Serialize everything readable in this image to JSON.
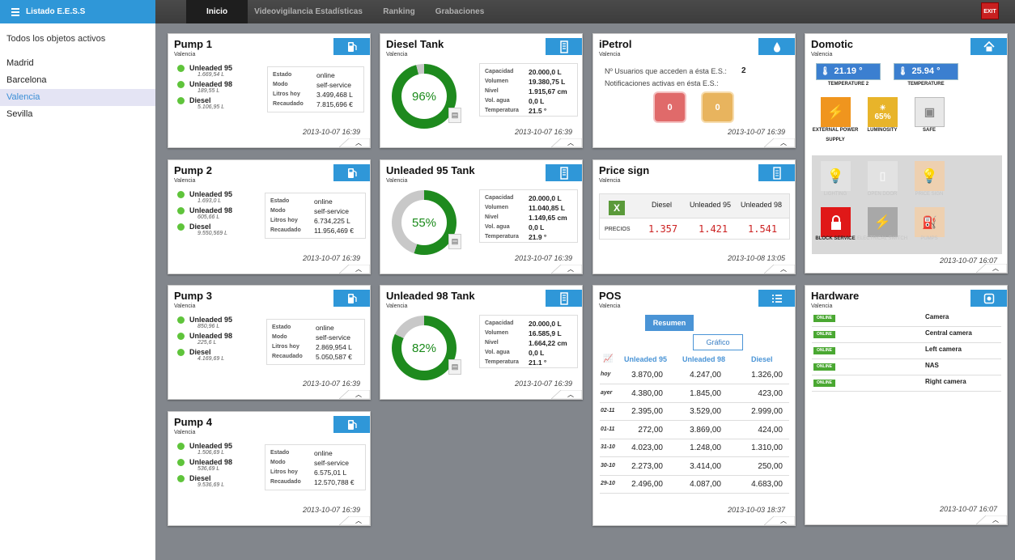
{
  "sidebar": {
    "title": "Listado E.E.S.S",
    "all_objects": "Todos los objetos activos",
    "items": [
      "Madrid",
      "Barcelona",
      "Valencia",
      "Sevilla"
    ],
    "active": "Valencia"
  },
  "nav": {
    "tabs": [
      "Inicio",
      "Videovigilancia Estadísticas",
      "Ranking",
      "Grabaciones"
    ],
    "active": "Inicio",
    "exit_label": "EXIT"
  },
  "pumps": [
    {
      "title": "Pump 1",
      "location": "Valencia",
      "fuels": [
        {
          "name": "Unleaded 95",
          "value": "1.669,54 L"
        },
        {
          "name": "Unleaded 98",
          "value": "189,55 L"
        },
        {
          "name": "Diesel",
          "value": "5.106,95 L"
        }
      ],
      "estado": "online",
      "modo": "self-service",
      "litros": "3.499,468 L",
      "recaudado": "7.815,696 €",
      "time": "2013-10-07 16:39"
    },
    {
      "title": "Pump 2",
      "location": "Valencia",
      "fuels": [
        {
          "name": "Unleaded 95",
          "value": "1.693,0 L"
        },
        {
          "name": "Unleaded 98",
          "value": "605,66 L"
        },
        {
          "name": "Diesel",
          "value": "9.550,569 L"
        }
      ],
      "estado": "online",
      "modo": "self-service",
      "litros": "6.734,225 L",
      "recaudado": "11.956,469 €",
      "time": "2013-10-07 16:39"
    },
    {
      "title": "Pump 3",
      "location": "Valencia",
      "fuels": [
        {
          "name": "Unleaded 95",
          "value": "850,96 L"
        },
        {
          "name": "Unleaded 98",
          "value": "225,6 L"
        },
        {
          "name": "Diesel",
          "value": "4.169,69 L"
        }
      ],
      "estado": "online",
      "modo": "self-service",
      "litros": "2.869,954 L",
      "recaudado": "5.050,587 €",
      "time": "2013-10-07 16:39"
    },
    {
      "title": "Pump 4",
      "location": "Valencia",
      "fuels": [
        {
          "name": "Unleaded 95",
          "value": "1.506,69 L"
        },
        {
          "name": "Unleaded 98",
          "value": "536,69 L"
        },
        {
          "name": "Diesel",
          "value": "9.536,69 L"
        }
      ],
      "estado": "online",
      "modo": "self-service",
      "litros": "6.575,01 L",
      "recaudado": "12.570,788 €",
      "time": "2013-10-07 16:39"
    }
  ],
  "pump_labels": {
    "estado": "Estado",
    "modo": "Modo",
    "litros": "Litros hoy",
    "recaudado": "Recaudado"
  },
  "tanks": [
    {
      "title": "Diesel Tank",
      "location": "Valencia",
      "percent": 96,
      "percent_label": "96%",
      "capacidad": "20.000,0 L",
      "volumen": "19.380,75 L",
      "nivel": "1.915,67 cm",
      "vol_agua": "0,0 L",
      "temperatura": "21.5 °",
      "time": "2013-10-07 16:39"
    },
    {
      "title": "Unleaded 95 Tank",
      "location": "Valencia",
      "percent": 55,
      "percent_label": "55%",
      "capacidad": "20.000,0 L",
      "volumen": "11.040,85 L",
      "nivel": "1.149,65 cm",
      "vol_agua": "0,0 L",
      "temperatura": "21.9 °",
      "time": "2013-10-07 16:39"
    },
    {
      "title": "Unleaded 98 Tank",
      "location": "Valencia",
      "percent": 82,
      "percent_label": "82%",
      "capacidad": "20.000,0 L",
      "volumen": "16.585,9 L",
      "nivel": "1.664,22 cm",
      "vol_agua": "0,0 L",
      "temperatura": "21.1 °",
      "time": "2013-10-07 16:39"
    }
  ],
  "tank_labels": {
    "capacidad": "Capacidad",
    "volumen": "Volumen",
    "nivel": "Nivel",
    "vol_agua": "Vol. agua",
    "temperatura": "Temperatura"
  },
  "ipetrol": {
    "title": "iPetrol",
    "location": "Valencia",
    "users_label": "Nº Usuarios que acceden a ésta E.S.:",
    "users_value": "2",
    "notif_label": "Notificaciones activas en ésta E.S.:",
    "red_count": "0",
    "orange_count": "0",
    "time": "2013-10-07 16:39"
  },
  "price_sign": {
    "title": "Price sign",
    "location": "Valencia",
    "columns": [
      "Diesel",
      "Unleaded 95",
      "Unleaded 98"
    ],
    "row_label": "PRECIOS",
    "prices": [
      "1.357",
      "1.421",
      "1.541"
    ],
    "time": "2013-10-08 13:05"
  },
  "pos": {
    "title": "POS",
    "location": "Valencia",
    "btn_resumen": "Resumen",
    "btn_grafico": "Gráfico",
    "columns": [
      "Unleaded 95",
      "Unleaded 98",
      "Diesel"
    ],
    "rows": [
      {
        "date": "hoy",
        "u95": "3.870,00",
        "u98": "4.247,00",
        "diesel": "1.326,00"
      },
      {
        "date": "ayer",
        "u95": "4.380,00",
        "u98": "1.845,00",
        "diesel": "423,00"
      },
      {
        "date": "02-11",
        "u95": "2.395,00",
        "u98": "3.529,00",
        "diesel": "2.999,00"
      },
      {
        "date": "01-11",
        "u95": "272,00",
        "u98": "3.869,00",
        "diesel": "424,00"
      },
      {
        "date": "31-10",
        "u95": "4.023,00",
        "u98": "1.248,00",
        "diesel": "1.310,00"
      },
      {
        "date": "30-10",
        "u95": "2.273,00",
        "u98": "3.414,00",
        "diesel": "250,00"
      },
      {
        "date": "29-10",
        "u95": "2.496,00",
        "u98": "4.087,00",
        "diesel": "4.683,00"
      }
    ],
    "time": "2013-10-03 18:37"
  },
  "domotic": {
    "title": "Domotic",
    "location": "Valencia",
    "temps": [
      {
        "value": "21.19 °",
        "label": "TEMPERATURE 2"
      },
      {
        "value": "25.94 °",
        "label": "TEMPERATURE"
      }
    ],
    "power_label": "EXTERNAL POWER SUPPLY",
    "luminosity_label": "LUMINOSITY",
    "luminosity_value": "65%",
    "safe_label": "SAFE",
    "lighting_label": "LIGHTING",
    "open_door_label": "OPEN DOOR",
    "price_sign_label": "PRICE SIGN",
    "block_label": "BLOCK SERVICE",
    "switch_label": "ELECTRICAL SWITCH",
    "pumps_label": "PUMPS",
    "time": "2013-10-07 16:07"
  },
  "hardware": {
    "title": "Hardware",
    "location": "Valencia",
    "badge": "ONLINE",
    "devices": [
      "Camera",
      "Central camera",
      "Left camera",
      "NAS",
      "Right camera"
    ],
    "time": "2013-10-07 16:07"
  },
  "colors": {
    "accent": "#2f97d8",
    "online": "#5fc43b",
    "tank_fill": "#1e8a1e",
    "tank_empty": "#c8c8c8",
    "price_red": "#cc2222"
  }
}
